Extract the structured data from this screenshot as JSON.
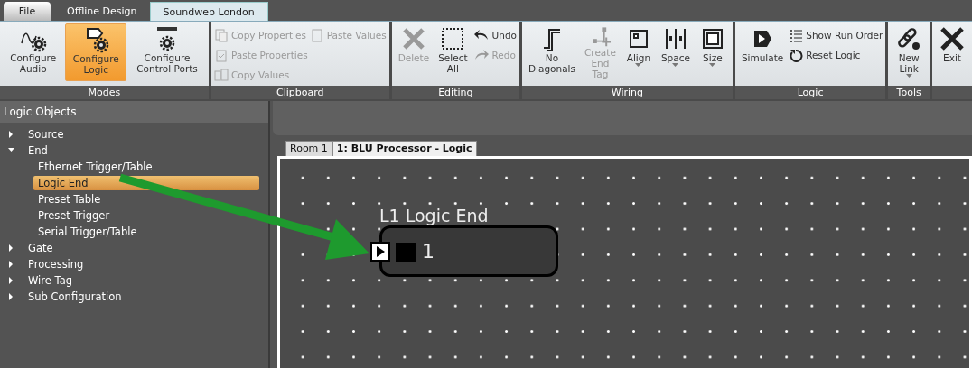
{
  "app_tabs": [
    {
      "label": "File",
      "selected": false,
      "kind": "file"
    },
    {
      "label": "Offline Design",
      "selected": false,
      "kind": "tab"
    },
    {
      "label": "Soundweb London",
      "selected": true,
      "kind": "tab"
    }
  ],
  "ribbon": {
    "groups": [
      {
        "label": "Modes",
        "items": [
          {
            "kind": "large",
            "label": "Configure Audio",
            "selected": false,
            "disabled": false
          },
          {
            "kind": "large",
            "label": "Configure Logic",
            "selected": true,
            "disabled": false
          },
          {
            "kind": "large",
            "label": "Configure Control Ports",
            "selected": false,
            "disabled": false
          }
        ]
      },
      {
        "label": "Clipboard",
        "items": [
          {
            "kind": "stack",
            "items": [
              {
                "label": "Copy Properties",
                "disabled": true
              },
              {
                "label": "Paste Properties",
                "disabled": true
              },
              {
                "label": "Copy Values",
                "disabled": true
              }
            ]
          },
          {
            "kind": "stack",
            "items": [
              {
                "label": "Paste Values",
                "disabled": true
              }
            ]
          }
        ]
      },
      {
        "label": "Editing",
        "items": [
          {
            "kind": "large",
            "label": "Delete",
            "selected": false,
            "disabled": true
          },
          {
            "kind": "large",
            "label": "Select All",
            "selected": false,
            "disabled": false
          },
          {
            "kind": "stack",
            "items": [
              {
                "label": "Undo",
                "disabled": false
              },
              {
                "label": "Redo",
                "disabled": true
              }
            ]
          }
        ]
      },
      {
        "label": "Wiring",
        "items": [
          {
            "kind": "large",
            "label": "No Diagonals",
            "selected": false,
            "disabled": false
          },
          {
            "kind": "large",
            "label": "Create End Tag",
            "selected": false,
            "disabled": true
          },
          {
            "kind": "large",
            "label": "Align",
            "selected": false,
            "disabled": false,
            "dropdown": true
          },
          {
            "kind": "large",
            "label": "Space",
            "selected": false,
            "disabled": false,
            "dropdown": true
          },
          {
            "kind": "large",
            "label": "Size",
            "selected": false,
            "disabled": false,
            "dropdown": true
          }
        ]
      },
      {
        "label": "Logic",
        "items": [
          {
            "kind": "large",
            "label": "Simulate",
            "selected": false,
            "disabled": false
          },
          {
            "kind": "stack",
            "items": [
              {
                "label": "Show Run Order",
                "disabled": false
              },
              {
                "label": "Reset Logic",
                "disabled": false
              }
            ]
          }
        ]
      },
      {
        "label": "Tools",
        "items": [
          {
            "kind": "large",
            "label": "New Link",
            "selected": false,
            "disabled": false,
            "dropdown": true
          }
        ]
      },
      {
        "items": [
          {
            "kind": "large",
            "label": "Exit",
            "selected": false,
            "disabled": false
          }
        ]
      }
    ]
  },
  "sidebar": {
    "title": "Logic Objects",
    "items": [
      {
        "label": "Source",
        "expanded": false
      },
      {
        "label": "End",
        "expanded": true,
        "children": [
          {
            "label": "Ethernet Trigger/Table",
            "selected": false
          },
          {
            "label": "Logic End",
            "selected": true
          },
          {
            "label": "Preset Table",
            "selected": false
          },
          {
            "label": "Preset Trigger",
            "selected": false
          },
          {
            "label": "Serial Trigger/Table",
            "selected": false
          }
        ]
      },
      {
        "label": "Gate",
        "expanded": false
      },
      {
        "label": "Processing",
        "expanded": false
      },
      {
        "label": "Wire Tag",
        "expanded": false
      },
      {
        "label": "Sub Configuration",
        "expanded": false
      }
    ]
  },
  "document_tabs": [
    {
      "label": "Room 1",
      "selected": false
    },
    {
      "label": "1: BLU Processor - Logic",
      "selected": true
    }
  ],
  "canvas": {
    "blocks": [
      {
        "title": "L1  Logic End",
        "input": "1"
      }
    ]
  }
}
